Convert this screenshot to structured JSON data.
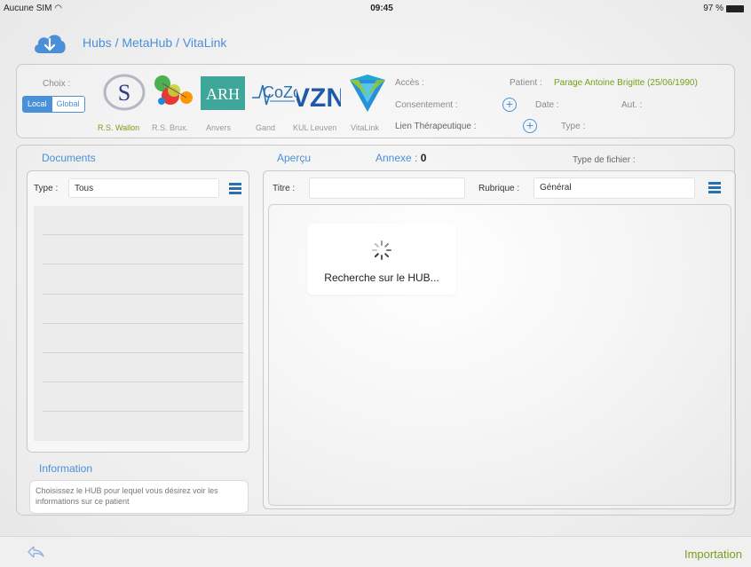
{
  "status_bar": {
    "carrier": "Aucune SIM",
    "time": "09:45",
    "battery": "97 %"
  },
  "header": {
    "title": "Hubs / MetaHub / VitaLink",
    "icon": "cloud-download-icon"
  },
  "hub_panel": {
    "choix_label": "Choix :",
    "toggle": {
      "local": "Local",
      "global": "Global",
      "selected": "Local"
    },
    "hubs": [
      {
        "name": "R.S. Wallon",
        "selected": true
      },
      {
        "name": "R.S. Brux."
      },
      {
        "name": "Anvers"
      },
      {
        "name": "Gand"
      },
      {
        "name": "KUL Leuven"
      },
      {
        "name": "VitaLink"
      }
    ],
    "logos": {
      "arh": "ARH",
      "cozo": "CoZo",
      "vzn": "VZN"
    },
    "acces_label": "Accès :",
    "consentement_label": "Consentement :",
    "lien_label": "Lien Thérapeutique :",
    "patient_label": "Patient :",
    "patient_value": "Parage Antoine Brigitte (25/06/1990)",
    "date_label": "Date :",
    "aut_label": "Aut. :",
    "type_label": "Type :"
  },
  "documents": {
    "title": "Documents",
    "type_label": "Type :",
    "type_value": "Tous"
  },
  "preview": {
    "title": "Aperçu",
    "annexe_label": "Annexe :",
    "annexe_count": "0",
    "file_type_label": "Type de fichier :",
    "titre_label": "Titre :",
    "titre_value": "",
    "rubrique_label": "Rubrique :",
    "rubrique_value": "Général",
    "loading_text": "Recherche sur le HUB..."
  },
  "information": {
    "title": "Information",
    "text": "Choisissez le HUB pour lequel vous désirez voir les informations sur ce patient"
  },
  "bottom": {
    "import_label": "Importation",
    "back_icon": "back-arrow-icon"
  },
  "colors": {
    "accent": "#4a90d9",
    "green": "#7a9e1b"
  }
}
